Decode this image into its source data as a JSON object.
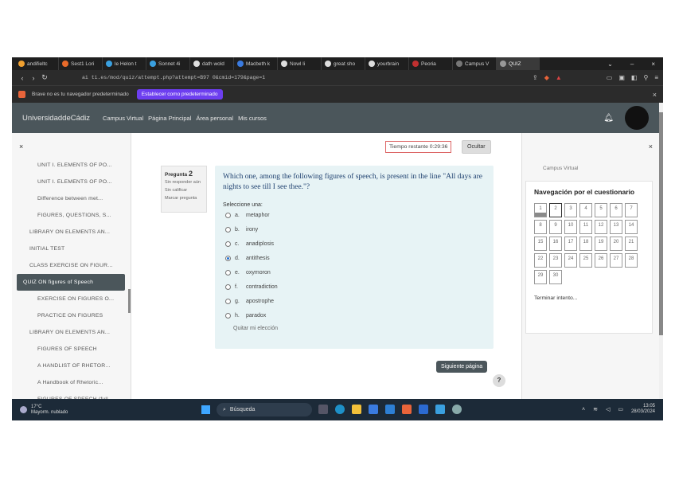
{
  "browser": {
    "tabs": [
      {
        "label": "andifieltc",
        "color": "#f0a030"
      },
      {
        "label": "Sest1 Lori",
        "color": "#e86a2a"
      },
      {
        "label": "le Helon t",
        "color": "#3aa0e0"
      },
      {
        "label": "Sonnet 4i",
        "color": "#3aa0e0"
      },
      {
        "label": "dath wold",
        "color": "#dddddd"
      },
      {
        "label": "Macbeth k",
        "color": "#3a7be0"
      },
      {
        "label": "Nowl li",
        "color": "#dddddd"
      },
      {
        "label": "great sho",
        "color": "#dddddd"
      },
      {
        "label": "yourbrain",
        "color": "#dddddd"
      },
      {
        "label": "Peoria",
        "color": "#c03030"
      },
      {
        "label": "Campus V",
        "color": "#777777"
      },
      {
        "label": "QUIZ",
        "color": "#999999"
      }
    ],
    "url": "ai ti.es/mod/quiz/attempt.php?attempt=B97 0&cmid=179&page=1",
    "infobar_text": "Brave no es tu navegador predeterminado",
    "infobar_button": "Establecer como predeterminado",
    "close_glyph": "×"
  },
  "site": {
    "brand": "UniversidaddeCádiz",
    "nav": [
      "Campus Virtual",
      "Página Principal",
      "Área personal",
      "Mis cursos"
    ]
  },
  "drawer": {
    "close_glyph": "×",
    "items": [
      {
        "label": "UNIT I. ELEMENTS OF PO...",
        "level": 1
      },
      {
        "label": "UNIT I. ELEMENTS OF PO...",
        "level": 1
      },
      {
        "label": "Difference between met...",
        "level": 1
      },
      {
        "label": "FIGURES, QUESTIONS, S...",
        "level": 1
      },
      {
        "label": "LIBRARY ON ELEMENTS AN...",
        "level": 0
      },
      {
        "label": "INITIAL TEST",
        "level": 0
      },
      {
        "label": "CLASS EXERCISE ON FIGUR...",
        "level": 0
      },
      {
        "label": "QUIZ ON figures of Speech",
        "level": 0,
        "active": true
      },
      {
        "label": "EXERCISE ON FIGURES O...",
        "level": 1
      },
      {
        "label": "PRACTICE ON FIGURES",
        "level": 1
      },
      {
        "label": "LIBRARY ON ELEMENTS AN...",
        "level": 0
      },
      {
        "label": "FIGURES OF SPEECH",
        "level": 1
      },
      {
        "label": "A HANDLIST OF RHETOR...",
        "level": 1
      },
      {
        "label": "A Handbook of Rhetoric...",
        "level": 1
      },
      {
        "label": "FIGURES OF SPEECH (full...",
        "level": 1
      }
    ]
  },
  "quiz": {
    "timer": "Tiempo restante 0:29:36",
    "hide_label": "Ocultar",
    "question_label": "Pregunta",
    "question_number": "2",
    "status": "Sin responder aún",
    "points": "Sin calificar",
    "flag": "Marcar pregunta",
    "question_text": "Which one, among the following figures of speech, is present in the line \"All days are nights to see till I see thee.\"?",
    "prompt": "Seleccione una:",
    "options": [
      {
        "letter": "a.",
        "text": "metaphor",
        "selected": false
      },
      {
        "letter": "b.",
        "text": "irony",
        "selected": false
      },
      {
        "letter": "c.",
        "text": "anadiplosis",
        "selected": false
      },
      {
        "letter": "d.",
        "text": "antithesis",
        "selected": true
      },
      {
        "letter": "e.",
        "text": "oxymoron",
        "selected": false
      },
      {
        "letter": "f.",
        "text": "contradiction",
        "selected": false
      },
      {
        "letter": "g.",
        "text": "apostrophe",
        "selected": false
      },
      {
        "letter": "h.",
        "text": "paradox",
        "selected": false
      }
    ],
    "clear_label": "Quitar mi elección",
    "next_label": "Siguiente página",
    "help_glyph": "?"
  },
  "rightpanel": {
    "close_glyph": "×",
    "campus_label": "Campus Virtual",
    "nav_title": "Navegación por el cuestionario",
    "questions": [
      "1",
      "2",
      "3",
      "4",
      "5",
      "6",
      "7",
      "8",
      "9",
      "10",
      "11",
      "12",
      "13",
      "14",
      "15",
      "16",
      "17",
      "18",
      "19",
      "20",
      "21",
      "22",
      "23",
      "24",
      "25",
      "26",
      "27",
      "28",
      "29",
      "30"
    ],
    "answered": [
      "1"
    ],
    "current": "2",
    "finish_label": "Terminar intento..."
  },
  "taskbar": {
    "temp": "17°C",
    "weather": "Mayorm. nublado",
    "search": "Búsqueda",
    "time": "13:05",
    "date": "28/03/2024"
  }
}
